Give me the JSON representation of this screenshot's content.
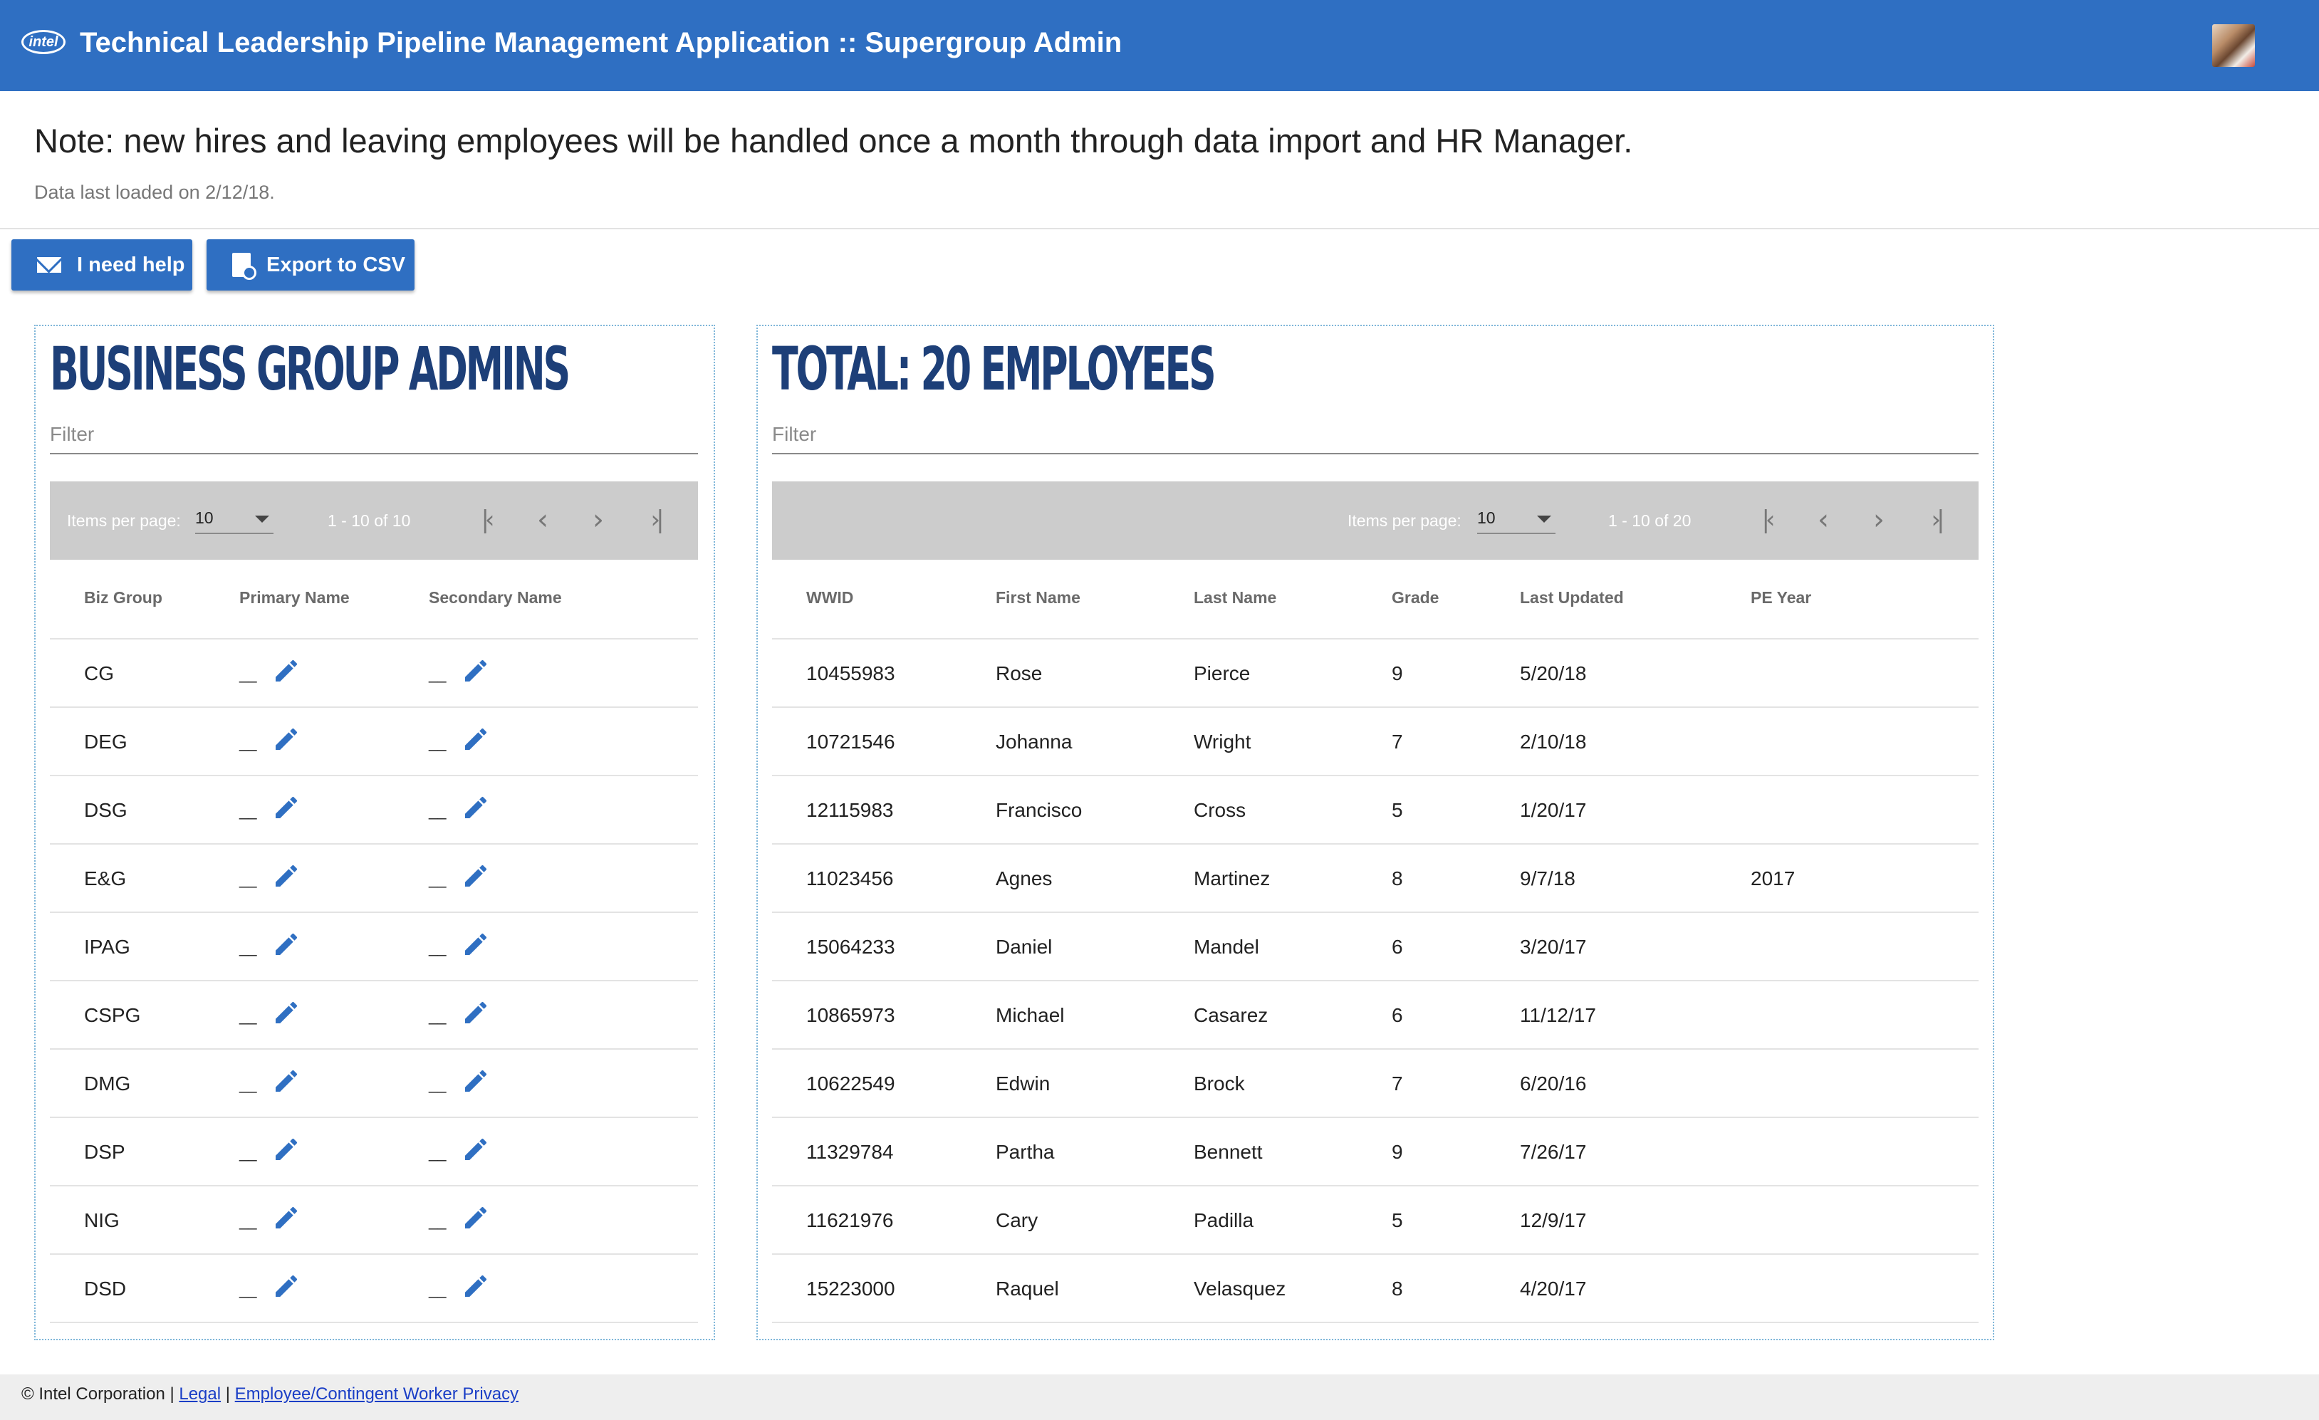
{
  "header": {
    "logo_text": "intel",
    "title": "Technical Leadership Pipeline Management Application :: Supergroup Admin"
  },
  "note": {
    "text": "Note: new hires and leaving employees will be handled once a month through data import and HR Manager.",
    "loaded": "Data last loaded on 2/12/18."
  },
  "buttons": {
    "help_label": "I need help",
    "export_label": "Export to CSV"
  },
  "bg_admins": {
    "title": "BUSINESS GROUP ADMINS",
    "filter_placeholder": "Filter",
    "paginator": {
      "items_label": "Items per page:",
      "page_size": "10",
      "range": "1 - 10 of 10"
    },
    "columns": [
      "Biz Group",
      "Primary Name",
      "Secondary Name"
    ],
    "rows": [
      {
        "group": "CG",
        "primary": "__",
        "secondary": "__"
      },
      {
        "group": "DEG",
        "primary": "__",
        "secondary": "__"
      },
      {
        "group": "DSG",
        "primary": "__",
        "secondary": "__"
      },
      {
        "group": "E&G",
        "primary": "__",
        "secondary": "__"
      },
      {
        "group": "IPAG",
        "primary": "__",
        "secondary": "__"
      },
      {
        "group": "CSPG",
        "primary": "__",
        "secondary": "__"
      },
      {
        "group": "DMG",
        "primary": "__",
        "secondary": "__"
      },
      {
        "group": "DSP",
        "primary": "__",
        "secondary": "__"
      },
      {
        "group": "NIG",
        "primary": "__",
        "secondary": "__"
      },
      {
        "group": "DSD",
        "primary": "__",
        "secondary": "__"
      }
    ]
  },
  "employees": {
    "title": "TOTAL: 20 EMPLOYEES",
    "filter_placeholder": "Filter",
    "paginator": {
      "items_label": "Items per page:",
      "page_size": "10",
      "range": "1 - 10 of 20"
    },
    "columns": [
      "WWID",
      "First Name",
      "Last Name",
      "Grade",
      "Last Updated",
      "PE Year"
    ],
    "rows": [
      {
        "wwid": "10455983",
        "first": "Rose",
        "last": "Pierce",
        "grade": "9",
        "updated": "5/20/18",
        "pe_year": ""
      },
      {
        "wwid": "10721546",
        "first": "Johanna",
        "last": "Wright",
        "grade": "7",
        "updated": "2/10/18",
        "pe_year": ""
      },
      {
        "wwid": "12115983",
        "first": "Francisco",
        "last": "Cross",
        "grade": "5",
        "updated": "1/20/17",
        "pe_year": ""
      },
      {
        "wwid": "11023456",
        "first": "Agnes",
        "last": "Martinez",
        "grade": "8",
        "updated": "9/7/18",
        "pe_year": "2017"
      },
      {
        "wwid": "15064233",
        "first": "Daniel",
        "last": "Mandel",
        "grade": "6",
        "updated": "3/20/17",
        "pe_year": ""
      },
      {
        "wwid": "10865973",
        "first": "Michael",
        "last": "Casarez",
        "grade": "6",
        "updated": "11/12/17",
        "pe_year": ""
      },
      {
        "wwid": "10622549",
        "first": "Edwin",
        "last": "Brock",
        "grade": "7",
        "updated": "6/20/16",
        "pe_year": ""
      },
      {
        "wwid": "11329784",
        "first": "Partha",
        "last": "Bennett",
        "grade": "9",
        "updated": "7/26/17",
        "pe_year": ""
      },
      {
        "wwid": "11621976",
        "first": "Cary",
        "last": "Padilla",
        "grade": "5",
        "updated": "12/9/17",
        "pe_year": ""
      },
      {
        "wwid": "15223000",
        "first": "Raquel",
        "last": "Velasquez",
        "grade": "8",
        "updated": "4/20/17",
        "pe_year": ""
      }
    ]
  },
  "footer": {
    "copyright": "© Intel Corporation |",
    "legal": "Legal",
    "separator": "|",
    "privacy": "Employee/Contingent Worker Privacy"
  },
  "colors": {
    "header_bg": "#2f6fc2",
    "title_navy": "#1d3f78",
    "pencil_blue": "#2f6fc2",
    "paginator_bg": "#cccccc"
  }
}
